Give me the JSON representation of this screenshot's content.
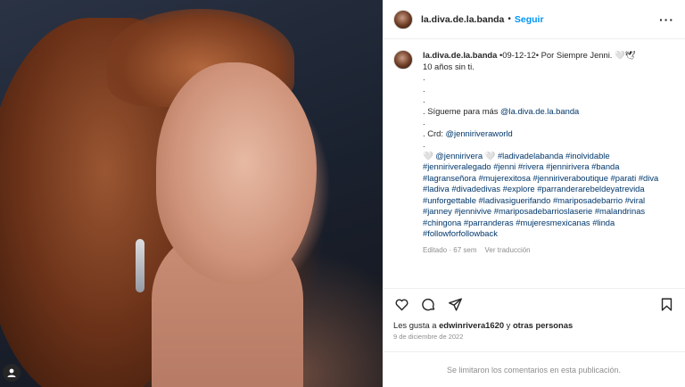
{
  "post": {
    "username": "la.diva.de.la.banda",
    "follow_label": "Seguir",
    "separator": "•",
    "more_label": "···"
  },
  "caption": {
    "username": "la.diva.de.la.banda",
    "line1": " •09-12-12• Por Siempre Jenni. 🤍🕊",
    "line2": "10 años sin ti.",
    "dot1": ".",
    "dot2": ".",
    "dot3": ".",
    "follow_prefix": ". Sígueme para más ",
    "follow_link": "@la.diva.de.la.banda",
    "dot4": ".",
    "credit_prefix": ". Crd: ",
    "credit_link": "@jenniriveraworld",
    "dot5": ".",
    "hashtag_lead": "🤍 ",
    "mention": "@jennirivera",
    "heart": " 🤍 ",
    "hashtags": "#ladivadelabanda #inolvidable #jenniriveralegado #jenni #rivera #jennirivera #banda #lagranseñora #mujerexitosa #jenniriveraboutique #parati #diva #ladiva #divadedivas #explore #parranderarebeldeyatrevida #unforgettable #ladivasiguerifando #mariposadebarrio #viral #janney #jennivive #mariposadebarrioslaserie #malandrinas #chingona #parranderas #mujeresmexicanas #linda #followforfollowback",
    "edited": "Editado · 67 sem",
    "translate": "Ver traducción"
  },
  "actions": {
    "like_icon": "heart-icon",
    "comment_icon": "comment-icon",
    "share_icon": "share-icon",
    "save_icon": "bookmark-icon"
  },
  "likes": {
    "prefix": "Les gusta a ",
    "user": "edwinrivera1620",
    "middle": " y ",
    "others": "otras personas"
  },
  "date": "9 de diciembre de 2022",
  "footer": "Se limitaron los comentarios en esta publicación."
}
